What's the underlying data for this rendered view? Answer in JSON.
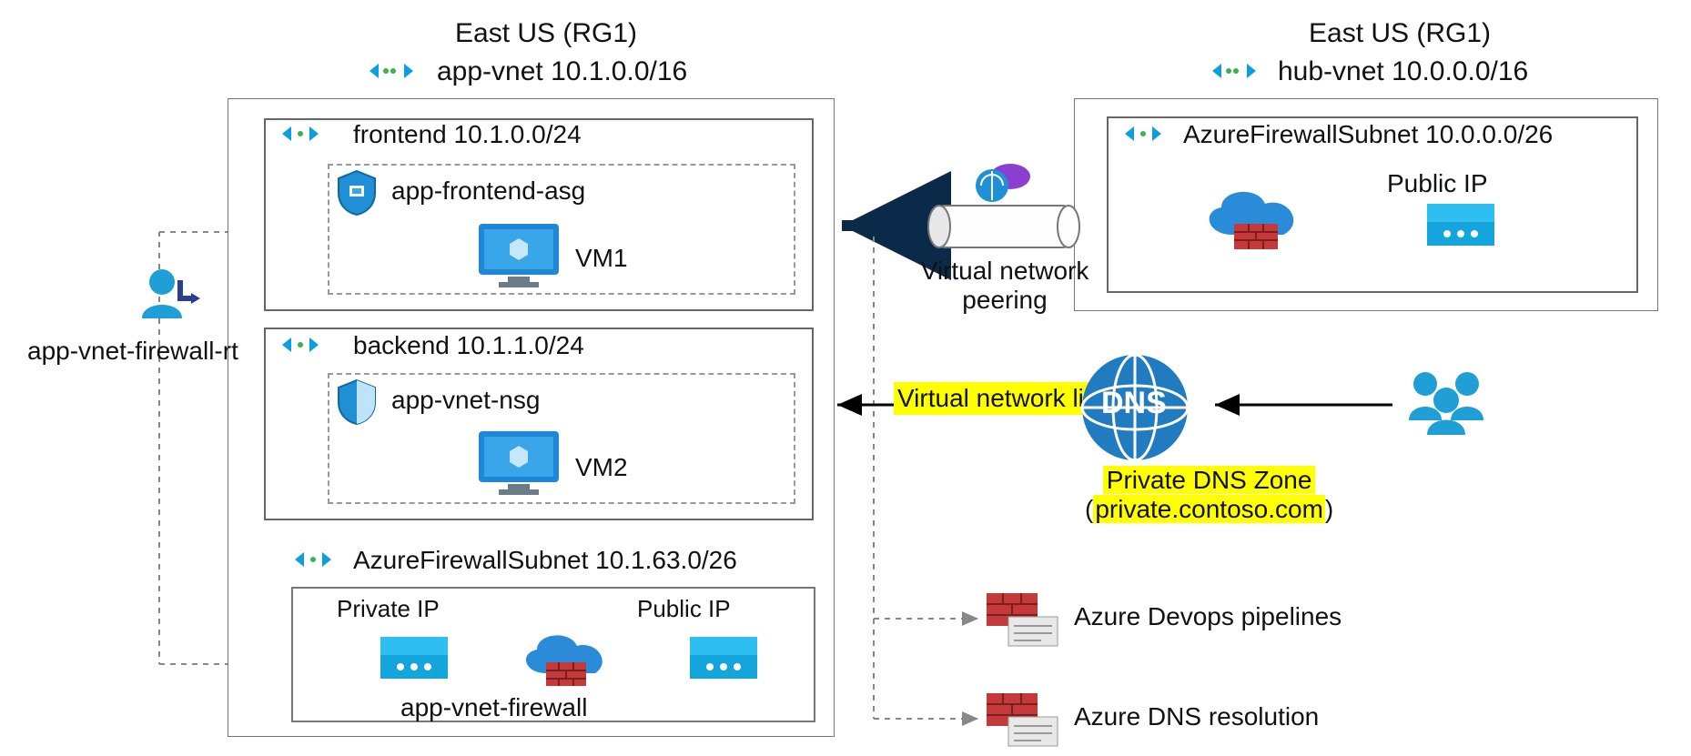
{
  "region_left": "East US (RG1)",
  "region_right": "East US (RG1)",
  "app_vnet": {
    "title": "app-vnet 10.1.0.0/16",
    "frontend": {
      "title": "frontend 10.1.0.0/24",
      "asg": "app-frontend-asg",
      "vm": "VM1"
    },
    "backend": {
      "title": "backend 10.1.1.0/24",
      "nsg": "app-vnet-nsg",
      "vm": "VM2"
    },
    "fw_subnet": {
      "title": "AzureFirewallSubnet 10.1.63.0/26",
      "private_ip": "Private IP",
      "public_ip": "Public IP",
      "fw_name": "app-vnet-firewall"
    }
  },
  "hub_vnet": {
    "title": "hub-vnet 10.0.0.0/16",
    "fw_subnet": {
      "title": "AzureFirewallSubnet 10.0.0.0/26",
      "public_ip": "Public IP"
    }
  },
  "route_table": "app-vnet-firewall-rt",
  "peering": "Virtual network peering",
  "vnet_link": "Virtual network link",
  "dns_label": "DNS",
  "dns_zone_line1": "Private DNS Zone",
  "dns_zone_line2": "(private.contoso.com)",
  "devops": "Azure Devops pipelines",
  "dns_res": "Azure DNS resolution"
}
